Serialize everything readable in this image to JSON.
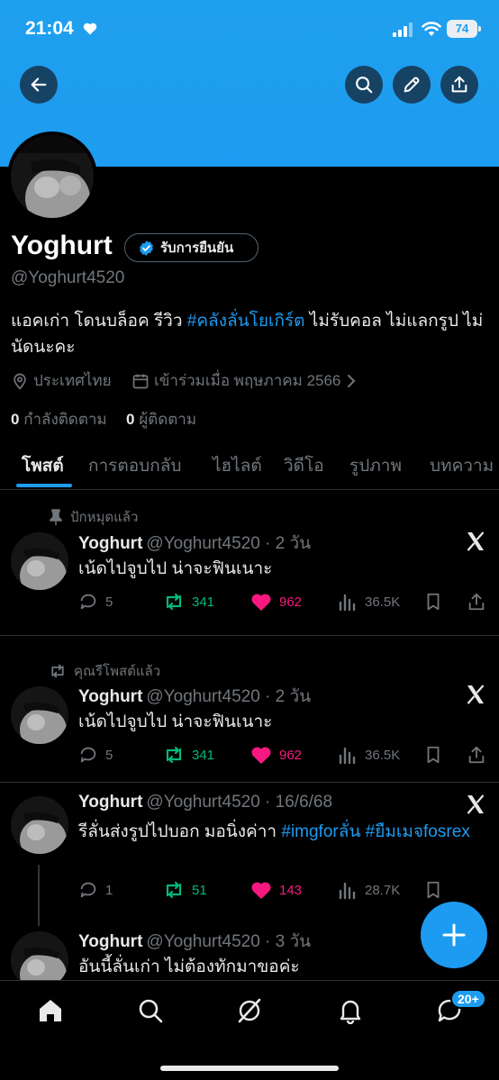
{
  "status_bar": {
    "time": "21:04",
    "battery": "74"
  },
  "profile": {
    "name": "Yoghurt",
    "verified_label": "รับการยืนยัน",
    "handle": "@Yoghurt4520",
    "bio_prefix": "แอคเก่า โดนบล็อค รีวิว ",
    "bio_hashtag": "#คลังลั่นโยเกิร์ต",
    "bio_suffix": " ไม่รับคอล ไม่แลกรูป ไม่นัดนะคะ",
    "location": "ประเทศไทย",
    "joined": "เข้าร่วมเมื่อ พฤษภาคม 2566",
    "following_count": "0",
    "following_label": "กำลังติดตาม",
    "followers_count": "0",
    "followers_label": "ผู้ติดตาม"
  },
  "tabs": [
    {
      "label": "โพสต์"
    },
    {
      "label": "การตอบกลับ"
    },
    {
      "label": "ไฮไลต์"
    },
    {
      "label": "วิดีโอ"
    },
    {
      "label": "รูปภาพ"
    },
    {
      "label": "บทความ"
    }
  ],
  "tweets": [
    {
      "context": "ปักหมุดแล้ว",
      "name": "Yoghurt",
      "meta": "@Yoghurt4520 · 2 วัน",
      "text": "เน้ดไปจูบไป น่าจะฟินเนาะ",
      "replies": "5",
      "reposts": "341",
      "likes": "962",
      "views": "36.5K"
    },
    {
      "context": "คุณรีโพสต์แล้ว",
      "name": "Yoghurt",
      "meta": "@Yoghurt4520 · 2 วัน",
      "text": "เน้ดไปจูบไป น่าจะฟินเนาะ",
      "replies": "5",
      "reposts": "341",
      "likes": "962",
      "views": "36.5K"
    },
    {
      "name": "Yoghurt",
      "meta": "@Yoghurt4520 · 16/6/68",
      "text_prefix": "รีลั่นส่งรูปไปบอก มอนิ่งค่าา ",
      "hashtag1": "#imgforลั่น",
      "hashtag2": "#ยืมเมจfosrex",
      "replies": "1",
      "reposts": "51",
      "likes": "143",
      "views": "28.7K"
    },
    {
      "name": "Yoghurt",
      "meta": "@Yoghurt4520 · 3 วัน",
      "text": "อันนี้ลั่นเก่า ไม่ต้องทักมาขอค่ะ"
    }
  ],
  "nav": {
    "messages_badge": "20+"
  },
  "colors": {
    "accent": "#1d9bf0",
    "repost": "#00ba7c",
    "like": "#f91880",
    "muted": "#71767b"
  }
}
